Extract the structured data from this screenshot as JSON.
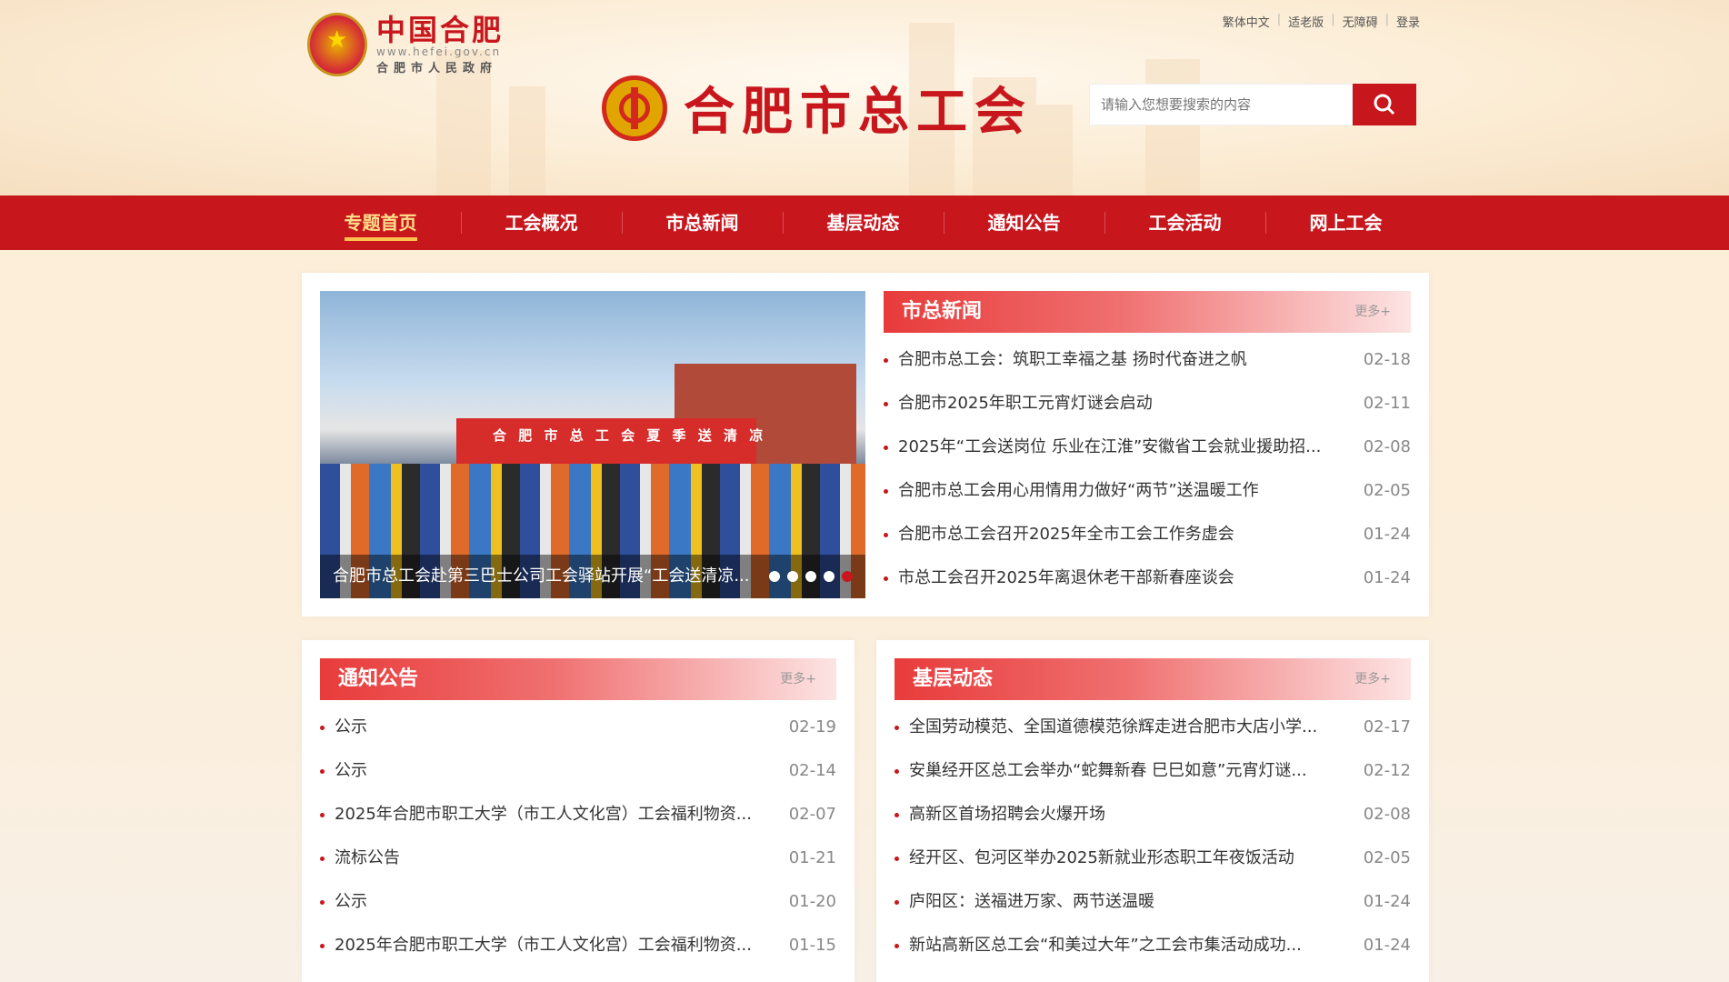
{
  "header": {
    "gov_name": "中国合肥",
    "gov_url": "www.hefei.gov.cn",
    "gov_sub": "合肥市人民政府",
    "site_name": "合肥市总工会",
    "top_links": [
      "繁体中文",
      "适老版",
      "无障碍",
      "登录"
    ],
    "search_placeholder": "请输入您想要搜索的内容"
  },
  "nav": {
    "items": [
      "专题首页",
      "工会概况",
      "市总新闻",
      "基层动态",
      "通知公告",
      "工会活动",
      "网上工会"
    ],
    "active": 0
  },
  "slider": {
    "caption": "合肥市总工会赴第三巴士公司工会驿站开展“工会送清凉...",
    "banner_text": "合 肥 市 总 工 会 夏 季 送 清 凉",
    "dots": 5,
    "active_dot": 4
  },
  "news": {
    "title": "市总新闻",
    "more": "更多+",
    "items": [
      {
        "title": "合肥市总工会：筑职工幸福之基 扬时代奋进之帆",
        "date": "02-18"
      },
      {
        "title": "合肥市2025年职工元宵灯谜会启动",
        "date": "02-11"
      },
      {
        "title": "2025年“工会送岗位 乐业在江淮”安徽省工会就业援助招...",
        "date": "02-08"
      },
      {
        "title": "合肥市总工会用心用情用力做好“两节”送温暖工作",
        "date": "02-05"
      },
      {
        "title": "合肥市总工会召开2025年全市工会工作务虚会",
        "date": "01-24"
      },
      {
        "title": "市总工会召开2025年离退休老干部新春座谈会",
        "date": "01-24"
      }
    ]
  },
  "notices": {
    "title": "通知公告",
    "more": "更多+",
    "items": [
      {
        "title": "公示",
        "date": "02-19"
      },
      {
        "title": "公示",
        "date": "02-14"
      },
      {
        "title": "2025年合肥市职工大学（市工人文化宫）工会福利物资...",
        "date": "02-07"
      },
      {
        "title": "流标公告",
        "date": "01-21"
      },
      {
        "title": "公示",
        "date": "01-20"
      },
      {
        "title": "2025年合肥市职工大学（市工人文化宫）工会福利物资...",
        "date": "01-15"
      }
    ]
  },
  "grassroots": {
    "title": "基层动态",
    "more": "更多+",
    "items": [
      {
        "title": "全国劳动模范、全国道德模范徐辉走进合肥市大店小学...",
        "date": "02-17"
      },
      {
        "title": "安巢经开区总工会举办“蛇舞新春 巳巳如意”元宵灯谜...",
        "date": "02-12"
      },
      {
        "title": "高新区首场招聘会火爆开场",
        "date": "02-08"
      },
      {
        "title": "经开区、包河区举办2025新就业形态职工年夜饭活动",
        "date": "02-05"
      },
      {
        "title": "庐阳区：送福进万家、两节送温暖",
        "date": "01-24"
      },
      {
        "title": "新站高新区总工会“和美过大年”之工会市集活动成功...",
        "date": "01-24"
      }
    ]
  },
  "colors": {
    "brand_red": "#c8161d",
    "accent_gold": "#ffc14d"
  }
}
